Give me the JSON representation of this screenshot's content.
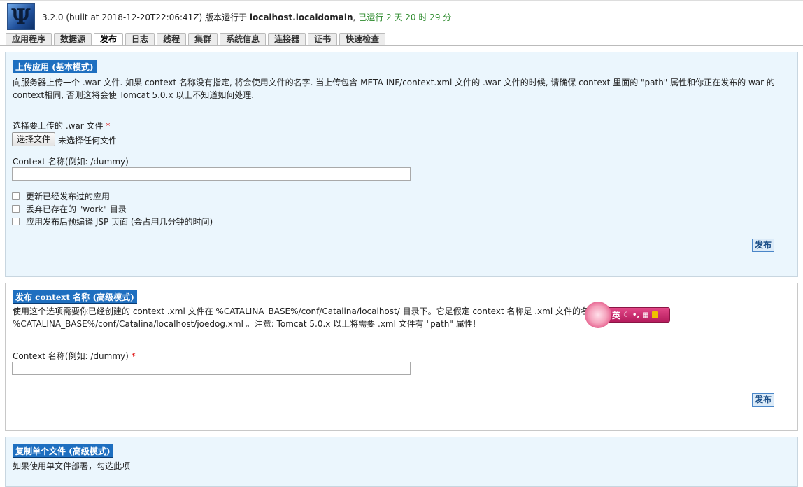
{
  "header": {
    "version": "3.2.0 (built at 2018-12-20T22:06:41Z)",
    "running_on_label": "版本运行于",
    "host": "localhost.localdomain",
    "comma": ",",
    "uptime": "已运行 2 天 20 时 29 分",
    "logo_icon": "psi-logo-icon"
  },
  "tabs": [
    {
      "label": "应用程序",
      "active": false
    },
    {
      "label": "数据源",
      "active": false
    },
    {
      "label": "发布",
      "active": true
    },
    {
      "label": "日志",
      "active": false
    },
    {
      "label": "线程",
      "active": false
    },
    {
      "label": "集群",
      "active": false
    },
    {
      "label": "系统信息",
      "active": false
    },
    {
      "label": "连接器",
      "active": false
    },
    {
      "label": "证书",
      "active": false
    },
    {
      "label": "快速检查",
      "active": false
    }
  ],
  "upload": {
    "title": "上传应用 (基本模式)",
    "desc_line1": "向服务器上传一个 .war 文件. 如果 context 名称没有指定, 将会使用文件的名字. 当上传包含 META-INF/context.xml 文件的 .war 文件的时候, 请确保 context 里面的 \"path\" 属性和你正在发布的 war 的",
    "desc_line2": "context相同, 否则这将会使 Tomcat 5.0.x 以上不知道如何处理.",
    "file_label": "选择要上传的 .war 文件",
    "required_mark": "*",
    "choose_button": "选择文件",
    "no_file": "未选择任何文件",
    "context_label": "Context 名称(例如: /dummy)",
    "context_value": "",
    "checkboxes": [
      {
        "label": "更新已经发布过的应用",
        "checked": false
      },
      {
        "label": "丢弃已存在的 \"work\" 目录",
        "checked": false
      },
      {
        "label": "应用发布后预编译 JSP 页面 (会占用几分钟的时间)",
        "checked": false
      }
    ],
    "submit": "发布"
  },
  "context_deploy": {
    "title": "发布 context 名称 (高级模式)",
    "desc_line1": "使用这个选项需要你已经创建的 context .xml 文件在 %CATALINA_BASE%/conf/Catalina/localhost/ 目录下。它是假定 context 名称是 .xml 文件的名称。例",
    "desc_line2": "%CATALINA_BASE%/conf/Catalina/localhost/joedog.xml 。注意: Tomcat 5.0.x 以上将需要 .xml 文件有 \"path\" 属性!",
    "context_label": "Context 名称(例如: /dummy)",
    "required_mark": "*",
    "context_value": "",
    "submit": "发布"
  },
  "copy_single": {
    "title": "复制单个文件 (高级模式)",
    "desc": "如果使用单文件部署，勾选此项"
  },
  "ime": {
    "mode_label": "英",
    "icons": [
      "moon-icon",
      "punctuation-icon",
      "keyboard-icon",
      "lock-icon"
    ]
  }
}
